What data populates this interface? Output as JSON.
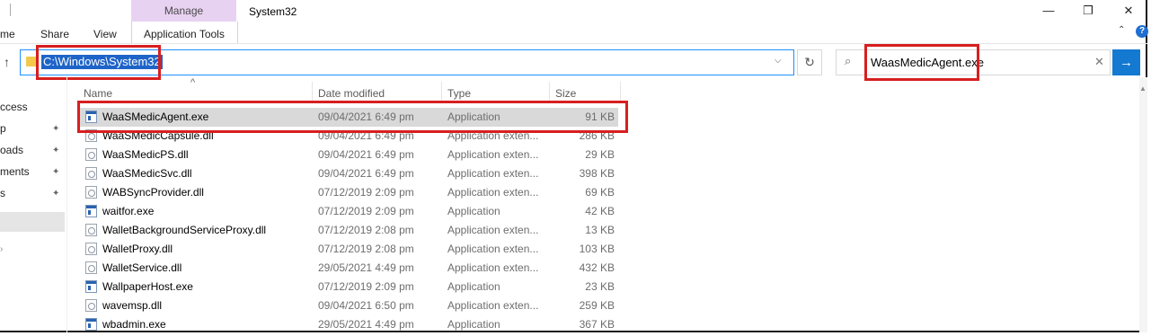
{
  "ribbon": {
    "file_tab_partial": "me",
    "share_tab": "Share",
    "view_tab": "View",
    "manage_label": "Manage",
    "app_tools_tab": "Application Tools",
    "window_title": "System32"
  },
  "window_controls": {
    "minimize": "—",
    "maximize": "❐",
    "close": "✕",
    "help": "?",
    "ribbon_toggle": "⌃"
  },
  "address": {
    "path": "C:\\Windows\\System32",
    "dropdown_glyph": "⌵",
    "refresh_glyph": "↻"
  },
  "search": {
    "value": "WaasMedicAgent.exe",
    "icon": "⌕",
    "clear_glyph": "✕",
    "go_glyph": "→"
  },
  "nav_pane": {
    "items": [
      {
        "label": "ccess",
        "pinned": false
      },
      {
        "label": "p",
        "pinned": true
      },
      {
        "label": "oads",
        "pinned": true
      },
      {
        "label": "ments",
        "pinned": true
      },
      {
        "label": "s",
        "pinned": true
      }
    ],
    "pin_glyph": "📌"
  },
  "columns": {
    "name": "Name",
    "date_modified": "Date modified",
    "type": "Type",
    "size": "Size",
    "sort_glyph": "^"
  },
  "files": [
    {
      "name": "WaaSMedicAgent.exe",
      "date": "09/04/2021 6:49 pm",
      "type": "Application",
      "size": "91 KB",
      "kind": "exe",
      "selected": true
    },
    {
      "name": "WaaSMedicCapsule.dll",
      "date": "09/04/2021 6:49 pm",
      "type": "Application exten...",
      "size": "286 KB",
      "kind": "dll"
    },
    {
      "name": "WaaSMedicPS.dll",
      "date": "09/04/2021 6:49 pm",
      "type": "Application exten...",
      "size": "29 KB",
      "kind": "dll"
    },
    {
      "name": "WaaSMedicSvc.dll",
      "date": "09/04/2021 6:49 pm",
      "type": "Application exten...",
      "size": "398 KB",
      "kind": "dll"
    },
    {
      "name": "WABSyncProvider.dll",
      "date": "07/12/2019 2:09 pm",
      "type": "Application exten...",
      "size": "69 KB",
      "kind": "dll"
    },
    {
      "name": "waitfor.exe",
      "date": "07/12/2019 2:09 pm",
      "type": "Application",
      "size": "42 KB",
      "kind": "exe"
    },
    {
      "name": "WalletBackgroundServiceProxy.dll",
      "date": "07/12/2019 2:08 pm",
      "type": "Application exten...",
      "size": "13 KB",
      "kind": "dll"
    },
    {
      "name": "WalletProxy.dll",
      "date": "07/12/2019 2:08 pm",
      "type": "Application exten...",
      "size": "103 KB",
      "kind": "dll"
    },
    {
      "name": "WalletService.dll",
      "date": "29/05/2021 4:49 pm",
      "type": "Application exten...",
      "size": "432 KB",
      "kind": "dll"
    },
    {
      "name": "WallpaperHost.exe",
      "date": "07/12/2019 2:09 pm",
      "type": "Application",
      "size": "23 KB",
      "kind": "exe"
    },
    {
      "name": "wavemsp.dll",
      "date": "09/04/2021 6:50 pm",
      "type": "Application exten...",
      "size": "259 KB",
      "kind": "dll"
    },
    {
      "name": "wbadmin.exe",
      "date": "29/05/2021 4:49 pm",
      "type": "Application",
      "size": "367 KB",
      "kind": "exe"
    }
  ],
  "colors": {
    "highlight_box": "#d71f1f",
    "manage_tab": "#e8d2f2",
    "selection_text_bg": "#1e64c8",
    "search_button": "#1479d1"
  }
}
